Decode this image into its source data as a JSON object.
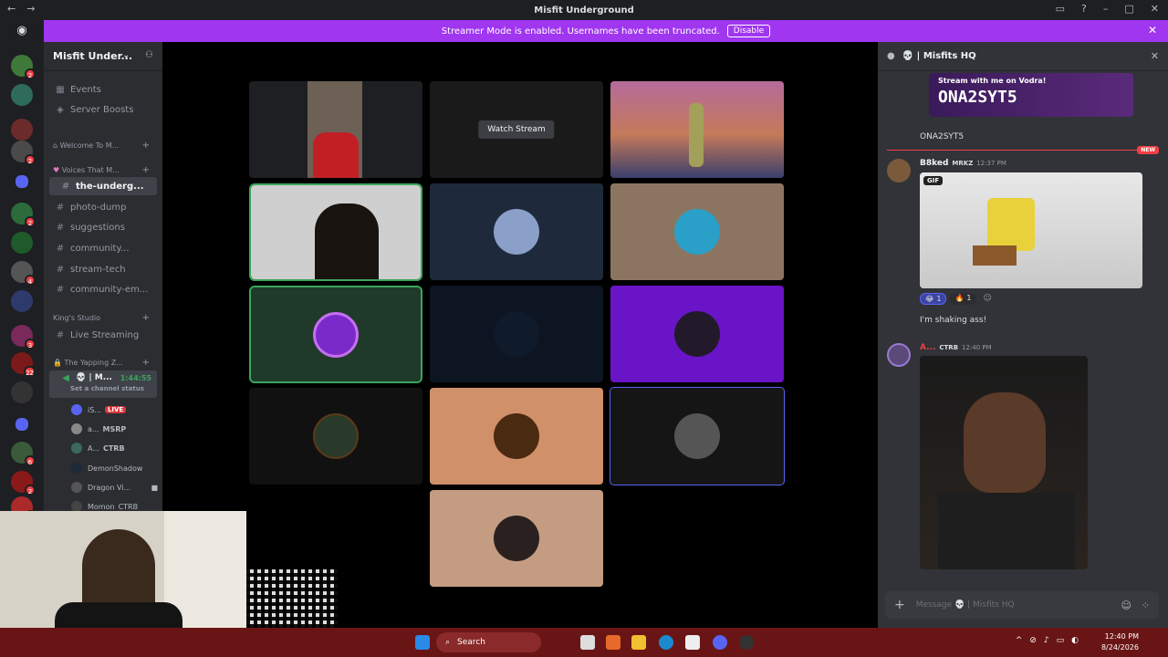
{
  "titlebar": {
    "title": "Misfit Underground",
    "back": "←",
    "forward": "→"
  },
  "banner": {
    "text": "Streamer Mode is enabled. Usernames have been truncated.",
    "disable_label": "Disable"
  },
  "rail": {
    "badges": [
      "2",
      "2",
      "2",
      "4",
      "3",
      "22",
      "6",
      "2",
      "8"
    ]
  },
  "sidebar": {
    "server_name": "Misfit Under...",
    "top_items": [
      {
        "label": "Events"
      },
      {
        "label": "Server Boosts"
      }
    ],
    "categories": [
      {
        "label": "Welcome To M..."
      },
      {
        "label": "Voices That M..."
      },
      {
        "label": "King's Studio"
      },
      {
        "label": "The Yapping Z..."
      }
    ],
    "channels": [
      {
        "label": "the-underg...",
        "active": true
      },
      {
        "label": "photo-dump"
      },
      {
        "label": "suggestions"
      },
      {
        "label": "community..."
      },
      {
        "label": "stream-tech"
      },
      {
        "label": "community-em..."
      }
    ],
    "live_streaming": "Live Streaming",
    "voice_self": {
      "name": "M...",
      "timer": "1:44:55",
      "status": "Set a channel status"
    },
    "voice_users": [
      {
        "name": "iS...",
        "tag": "LIVE"
      },
      {
        "name": "a...",
        "tag": "MSRP"
      },
      {
        "name": "A...",
        "tag": "CTRB"
      },
      {
        "name": "DemonShadow",
        "tag": ""
      },
      {
        "name": "Dragon Vi...",
        "tag": ""
      },
      {
        "name": "Momon",
        "tag": "CTRB"
      }
    ]
  },
  "stage": {
    "watch_label": "Watch Stream"
  },
  "chat": {
    "title": "Misfits HQ",
    "promo_small": "Stream with me on Vodra!",
    "promo_code": "ONA2SYT5",
    "code_text": "ONA2SYT5",
    "new_label": "NEW",
    "msg1": {
      "user": "B8ked",
      "tag": "MRKZ",
      "time": "12:37 PM",
      "gif_label": "GIF",
      "reactions": [
        {
          "emoji": "😂",
          "count": "1"
        },
        {
          "emoji": "🔥",
          "count": "1"
        }
      ],
      "text": "I'm shaking ass!"
    },
    "msg2": {
      "user": "A...",
      "tag": "CTRB",
      "time": "12:40 PM"
    },
    "composer_placeholder": "Message 💀 | Misfits HQ"
  },
  "taskbar": {
    "search": "Search",
    "time": "12:40 PM",
    "date": "8/24/2026"
  }
}
